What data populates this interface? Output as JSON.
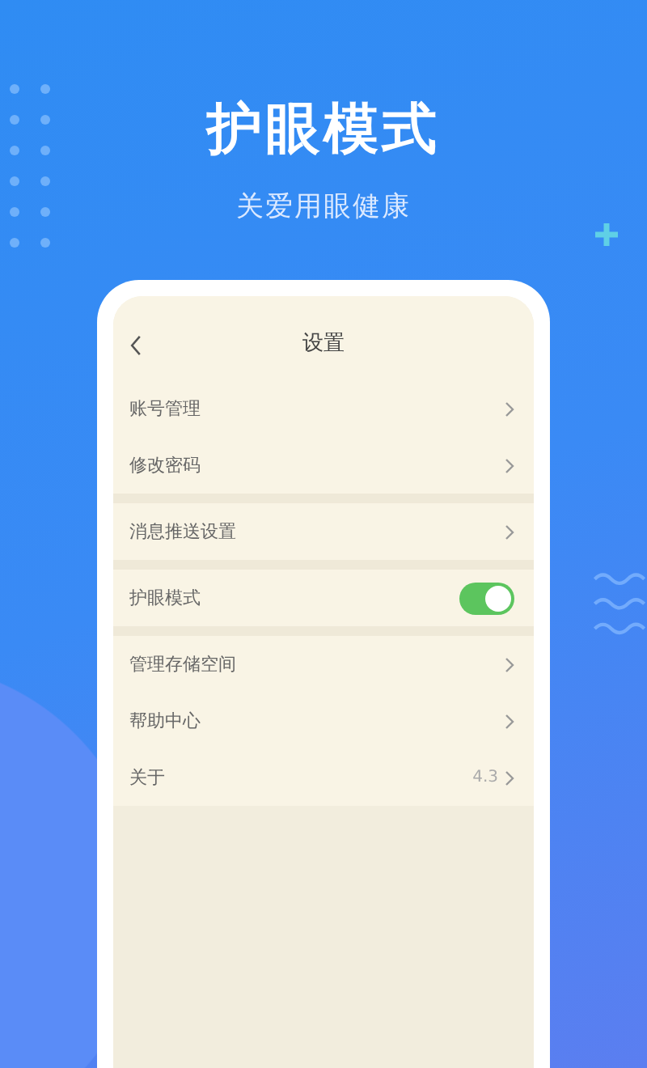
{
  "headline": "护眼模式",
  "tagline": "关爱用眼健康",
  "screen": {
    "title": "设置",
    "groups": [
      {
        "items": [
          {
            "kind": "link",
            "label": "账号管理"
          },
          {
            "kind": "link",
            "label": "修改密码"
          }
        ]
      },
      {
        "items": [
          {
            "kind": "link",
            "label": "消息推送设置"
          }
        ]
      },
      {
        "items": [
          {
            "kind": "toggle",
            "label": "护眼模式",
            "on": true
          }
        ]
      },
      {
        "items": [
          {
            "kind": "link",
            "label": "管理存储空间"
          },
          {
            "kind": "link",
            "label": "帮助中心"
          },
          {
            "kind": "link",
            "label": "关于",
            "value": "4.3"
          }
        ]
      }
    ]
  }
}
